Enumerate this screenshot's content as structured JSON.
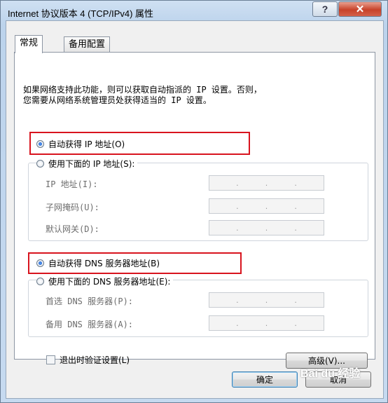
{
  "window": {
    "title": "Internet 协议版本 4 (TCP/IPv4) 属性",
    "help_label": "?",
    "close_label": "✕"
  },
  "tabs": [
    {
      "label": "常规"
    },
    {
      "label": "备用配置"
    }
  ],
  "description": {
    "line1": "如果网络支持此功能，则可以获取自动指派的 IP 设置。否则，",
    "line2": "您需要从网络系统管理员处获得适当的 IP 设置。"
  },
  "ip": {
    "auto_label": "自动获得 IP 地址(O)",
    "manual_label": "使用下面的 IP 地址(S):",
    "fields": [
      {
        "label": "IP 地址(I):"
      },
      {
        "label": "子网掩码(U):"
      },
      {
        "label": "默认网关(D):"
      }
    ]
  },
  "dns": {
    "auto_label": "自动获得 DNS 服务器地址(B)",
    "manual_label": "使用下面的 DNS 服务器地址(E):",
    "fields": [
      {
        "label": "首选 DNS 服务器(P):"
      },
      {
        "label": "备用 DNS 服务器(A):"
      }
    ]
  },
  "validate_label": "退出时验证设置(L)",
  "advanced_label": "高级(V)...",
  "ok_label": "确定",
  "cancel_label": "取消",
  "watermark": "Bai du 经验",
  "colors": {
    "highlight_box": "#d8141e"
  }
}
